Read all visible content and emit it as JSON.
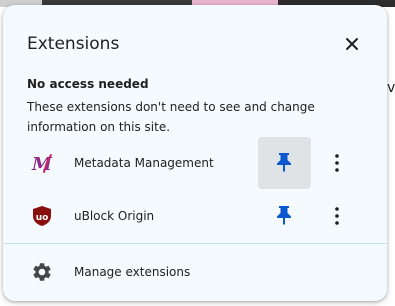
{
  "background": {
    "peek_text": "ve",
    "colors": {
      "tab_strip": "#d8d8d8",
      "accent_bar": "#e9b5cf"
    }
  },
  "popup": {
    "title": "Extensions",
    "close_icon": "close-icon",
    "section": {
      "heading": "No access needed",
      "description": "These extensions don't need to see and change information on this site."
    },
    "extensions": [
      {
        "name": "Metadata Management",
        "icon": "metadata-management-icon",
        "pinned": true,
        "pin_icon": "pin-icon",
        "menu_icon": "more-vert-icon"
      },
      {
        "name": "uBlock Origin",
        "icon": "ublock-origin-icon",
        "pinned": true,
        "pin_icon": "pin-icon",
        "menu_icon": "more-vert-icon"
      }
    ],
    "manage": {
      "label": "Manage extensions",
      "icon": "gear-icon"
    },
    "colors": {
      "background": "#f4fafd",
      "pin": "#0b57d0",
      "divider": "#bfe3ea",
      "hover": "#dfe3e6",
      "text": "#1f1f1f"
    }
  }
}
